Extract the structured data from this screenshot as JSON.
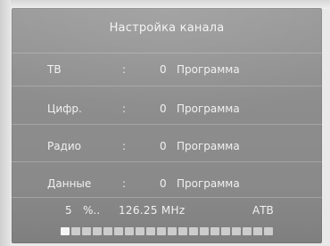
{
  "menu": {
    "title": "Настройка канала",
    "rows": [
      {
        "label": "ТВ",
        "colon": ":",
        "count": "0",
        "unit": "Программа"
      },
      {
        "label": "Цифр.",
        "colon": ":",
        "count": "0",
        "unit": "Программа"
      },
      {
        "label": "Радио",
        "colon": ":",
        "count": "0",
        "unit": "Программа"
      },
      {
        "label": "Данные",
        "colon": ":",
        "count": "0",
        "unit": "Программа"
      }
    ]
  },
  "scan": {
    "percent": "5",
    "percent_suffix": "%..",
    "frequency": "126.25 MHz",
    "system": "АТВ",
    "progress_segments": 20,
    "progress_fraction": 0.05
  }
}
